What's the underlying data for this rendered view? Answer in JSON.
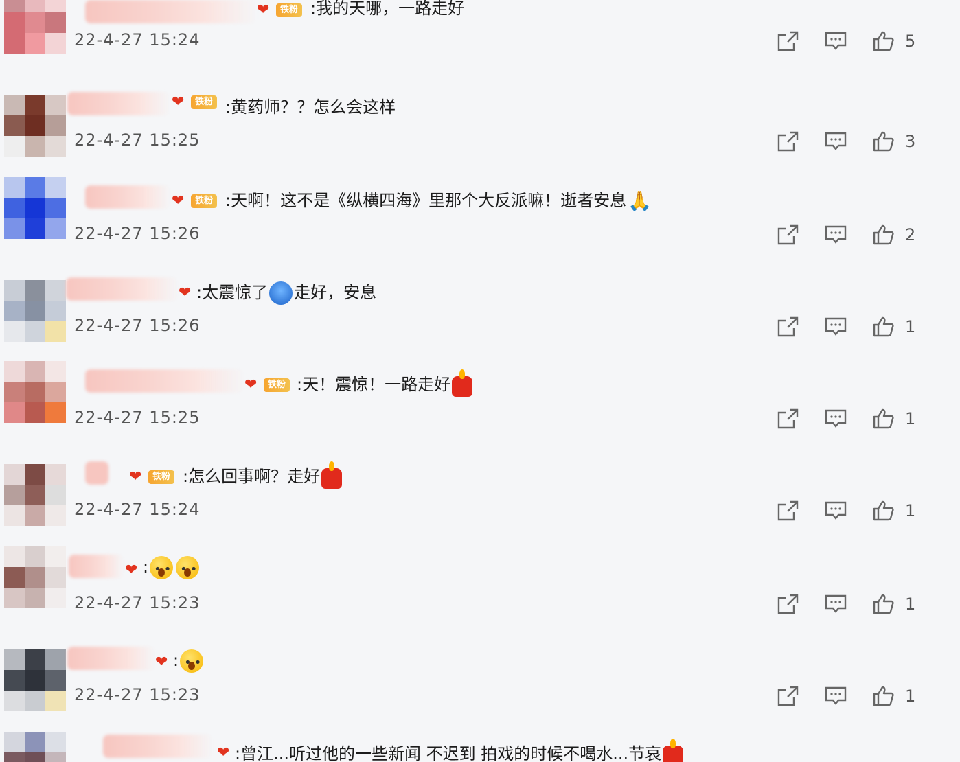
{
  "comments": [
    {
      "text": ":我的天哪，一路走好",
      "time": "22-4-27 15:24",
      "likes": "5",
      "fan_badge": "铁粉",
      "trailing_emoji": ""
    },
    {
      "text": ":黄药师？？怎么会这样",
      "time": "22-4-27 15:25",
      "likes": "3",
      "fan_badge": "铁粉",
      "trailing_emoji": ""
    },
    {
      "text": ":天啊！这不是《纵横四海》里那个大反派嘛！逝者安息",
      "time": "22-4-27 15:26",
      "likes": "2",
      "fan_badge": "铁粉",
      "trailing_emoji": "pray"
    },
    {
      "text": ":太震惊了",
      "text_after": "走好，安息",
      "time": "22-4-27 15:26",
      "likes": "1",
      "fan_badge": "",
      "trailing_emoji": ""
    },
    {
      "text": ":天！震惊！一路走好",
      "time": "22-4-27 15:25",
      "likes": "1",
      "fan_badge": "铁粉",
      "trailing_emoji": "candle"
    },
    {
      "text": ":怎么回事啊？走好",
      "time": "22-4-27 15:24",
      "likes": "1",
      "fan_badge": "铁粉",
      "trailing_emoji": "candle"
    },
    {
      "text": ":",
      "time": "22-4-27 15:23",
      "likes": "1",
      "fan_badge": "",
      "trailing_emoji": "shock-shock"
    },
    {
      "text": ":",
      "time": "22-4-27 15:23",
      "likes": "1",
      "fan_badge": "",
      "trailing_emoji": "shock"
    },
    {
      "text": ":曾江...听过他的一些新闻 不迟到 拍戏的时候不喝水...节哀",
      "time": "",
      "likes": "",
      "fan_badge": "",
      "trailing_emoji": "candle"
    }
  ],
  "icons": {
    "share": "share-icon",
    "reply": "comment-icon",
    "like": "thumbs-up-icon"
  },
  "colors": {
    "badge_orange": "#f6a531",
    "heart_red": "#e2341f",
    "icon_gray": "#666666"
  }
}
